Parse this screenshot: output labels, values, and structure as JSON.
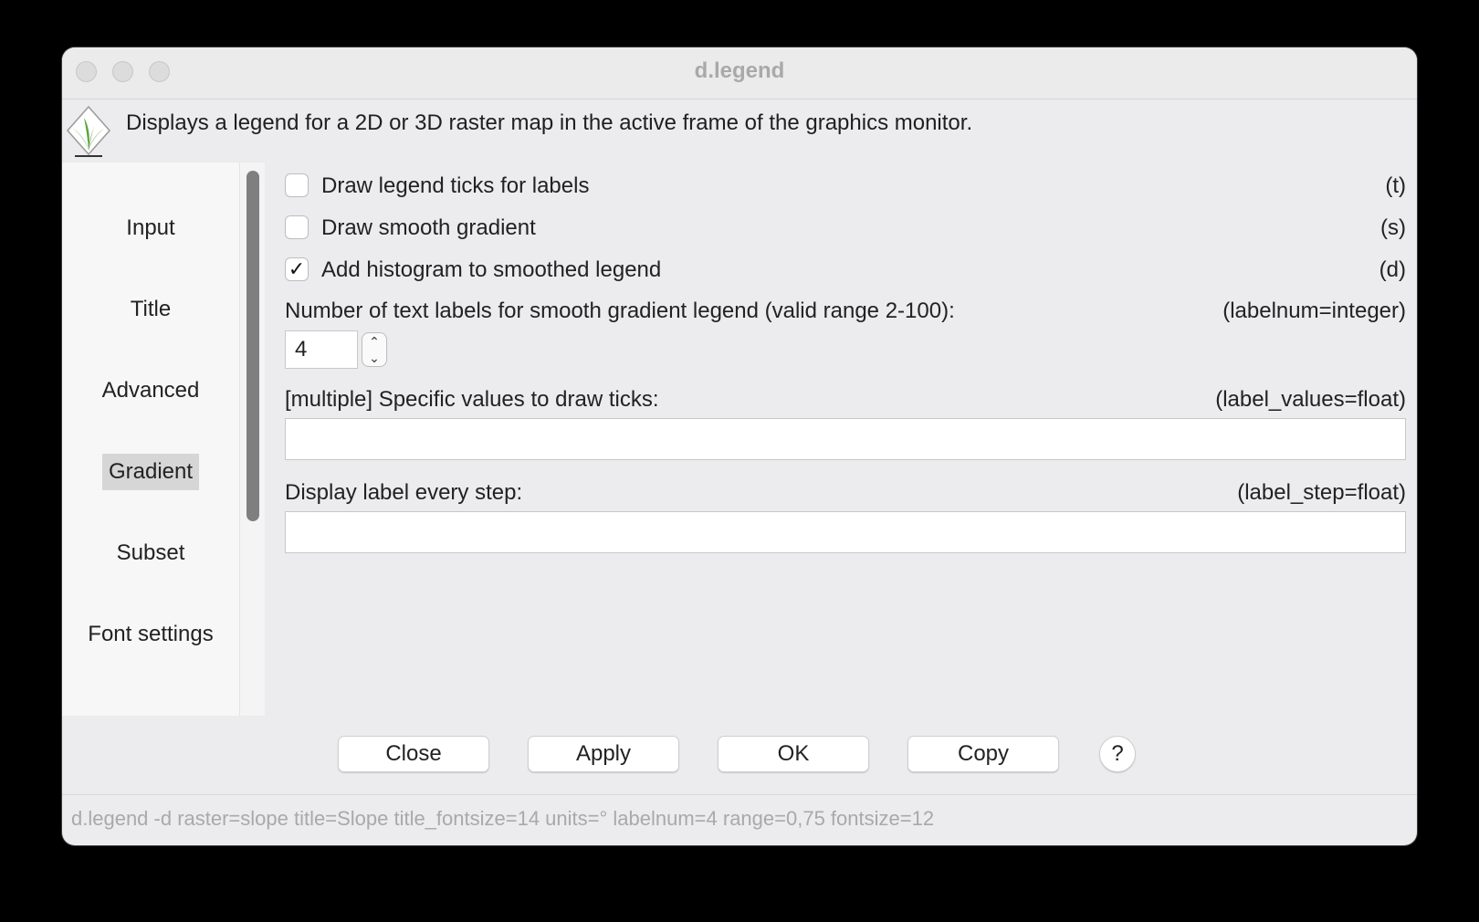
{
  "window": {
    "title": "d.legend"
  },
  "description": "Displays a legend for a 2D or 3D raster map in the active frame of the graphics monitor.",
  "sidebar": {
    "items": [
      {
        "label": "Input",
        "selected": false
      },
      {
        "label": "Title",
        "selected": false
      },
      {
        "label": "Advanced",
        "selected": false
      },
      {
        "label": "Gradient",
        "selected": true
      },
      {
        "label": "Subset",
        "selected": false
      },
      {
        "label": "Font settings",
        "selected": false
      }
    ]
  },
  "options": {
    "ticks": {
      "label": "Draw legend ticks for labels",
      "flag": "(t)",
      "checked": false
    },
    "smooth": {
      "label": "Draw smooth gradient",
      "flag": "(s)",
      "checked": false
    },
    "histogram": {
      "label": "Add histogram to smoothed legend",
      "flag": "(d)",
      "checked": true,
      "check_glyph": "✓"
    },
    "labelnum": {
      "label": "Number of text labels for smooth gradient legend (valid range 2-100):",
      "flag": "(labelnum=integer)",
      "value": "4"
    },
    "label_values": {
      "label": "[multiple] Specific values to draw ticks:",
      "flag": "(label_values=float)",
      "value": ""
    },
    "label_step": {
      "label": "Display label every step:",
      "flag": "(label_step=float)",
      "value": ""
    }
  },
  "buttons": {
    "close": "Close",
    "apply": "Apply",
    "ok": "OK",
    "copy": "Copy",
    "help": "?"
  },
  "status": "d.legend -d raster=slope title=Slope title_fontsize=14 units=° labelnum=4 range=0,75 fontsize=12",
  "colors": {
    "window_bg": "#ecebed",
    "sidebar_bg": "#f7f7f7",
    "selected_bg": "#d6d6d6",
    "status_text": "#a9a9a9"
  }
}
